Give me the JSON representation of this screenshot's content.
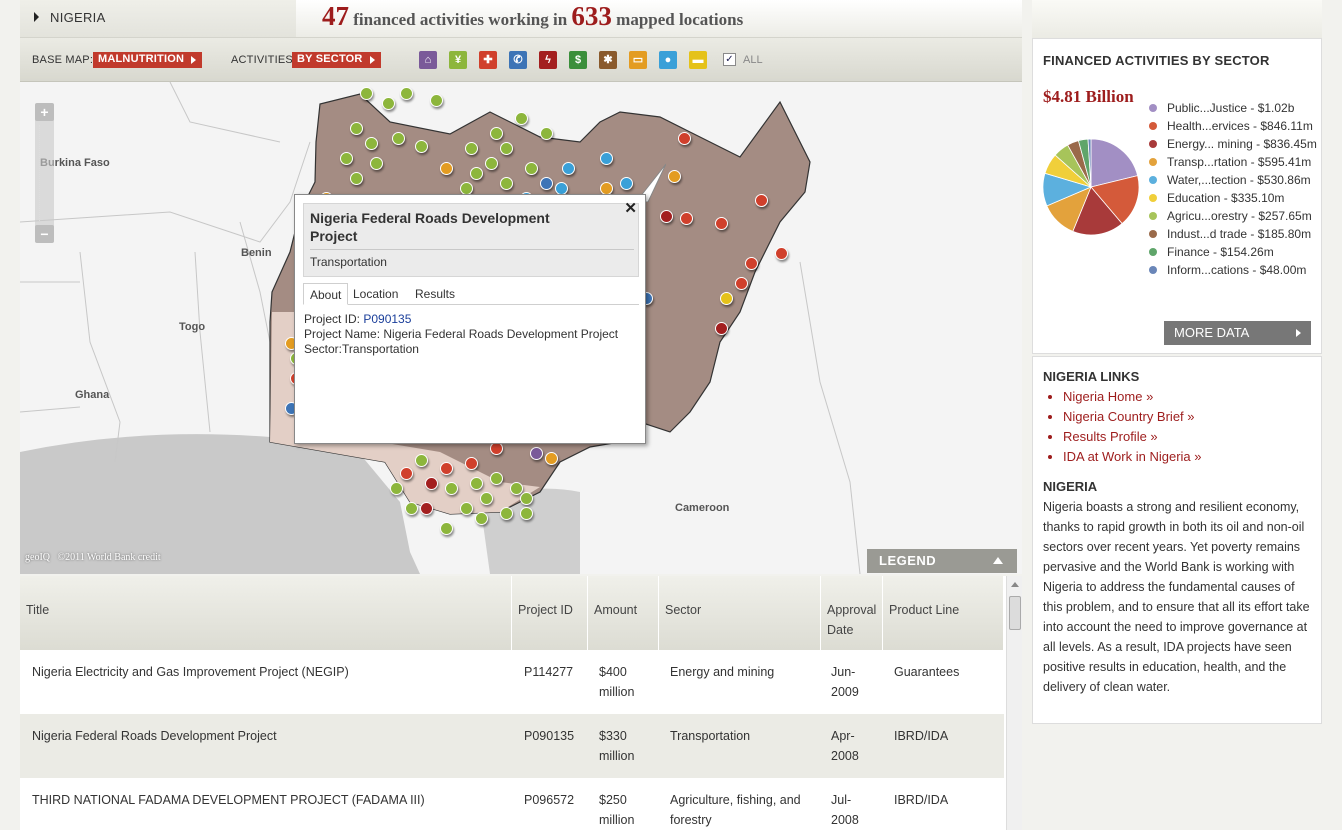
{
  "country": "NIGERIA",
  "headline": {
    "count": "47",
    "text1": "financed activities working in",
    "locations": "633",
    "text2": "mapped locations"
  },
  "toolbar": {
    "basemap_label": "BASE MAP:",
    "basemap_value": "MALNUTRITION",
    "activities_label": "ACTIVITIES:",
    "activities_value": "BY SECTOR",
    "all_label": "ALL",
    "all_checked": true,
    "sector_icons": [
      {
        "icon": "bank-icon",
        "color": "#7a5a99"
      },
      {
        "icon": "wheat-icon",
        "color": "#8db63c"
      },
      {
        "icon": "health-cross-icon",
        "color": "#d0402c"
      },
      {
        "icon": "phone-icon",
        "color": "#3d74b6"
      },
      {
        "icon": "energy-icon",
        "color": "#a31f1f"
      },
      {
        "icon": "dollar-icon",
        "color": "#3b8f3b"
      },
      {
        "icon": "industry-gear-icon",
        "color": "#8a5a2c"
      },
      {
        "icon": "transport-car-icon",
        "color": "#e39c22"
      },
      {
        "icon": "water-drop-icon",
        "color": "#3aa0d8"
      },
      {
        "icon": "education-book-icon",
        "color": "#e5c21a"
      }
    ]
  },
  "map": {
    "countries": [
      "Burkina Faso",
      "Benin",
      "Togo",
      "Ghana",
      "Cameroon"
    ],
    "credit_logo": "geoIQ",
    "credit": "©2011 World Bank credit",
    "legend_label": "LEGEND",
    "zoom_in": "+",
    "zoom_out": "−"
  },
  "popup": {
    "title": "Nigeria Federal Roads Development Project",
    "subtitle": "Transportation",
    "close": "✕",
    "tabs": [
      "About",
      "Location",
      "Results"
    ],
    "active_tab": "About",
    "project_id_label": "Project ID:",
    "project_id": "P090135",
    "project_name_line": "Project Name: Nigeria Federal Roads Development Project",
    "sector_line": "Sector:Transportation"
  },
  "table": {
    "headers": [
      "Title",
      "Project ID",
      "Amount",
      "Sector",
      "Approval Date",
      "Product Line"
    ],
    "rows": [
      {
        "title": "Nigeria Electricity and Gas Improvement Project (NEGIP)",
        "id": "P114277",
        "amount": "$400 million",
        "sector": "Energy and mining",
        "date": "Jun-2009",
        "product": "Guarantees"
      },
      {
        "title": "Nigeria Federal Roads Development Project",
        "id": "P090135",
        "amount": "$330 million",
        "sector": "Transportation",
        "date": "Apr-2008",
        "product": "IBRD/IDA"
      },
      {
        "title": "THIRD NATIONAL FADAMA DEVELOPMENT PROJECT (FADAMA III)",
        "id": "P096572",
        "amount": "$250 million",
        "sector": "Agriculture, fishing, and forestry",
        "date": "Jul-2008",
        "product": "IBRD/IDA"
      }
    ]
  },
  "sidebar": {
    "title": "FINANCED ACTIVITIES BY SECTOR",
    "total": "$4.81 Billion",
    "more_data": "MORE DATA",
    "links_title": "NIGERIA LINKS",
    "links": [
      "Nigeria Home »",
      "Nigeria Country Brief »",
      "Results Profile »",
      "IDA at Work in Nigeria »"
    ],
    "about_title": "NIGERIA",
    "about_text": "Nigeria boasts a strong and resilient economy, thanks to rapid growth in both its oil and non-oil sectors over recent years. Yet poverty remains pervasive and the World Bank is working with Nigeria to address the fundamental causes of this problem, and to ensure that all its effort take into account the need to improve governance at all levels. As a result, IDA projects have seen positive results in education, health, and the delivery of clean water."
  },
  "chart_data": {
    "type": "pie",
    "title": "FINANCED ACTIVITIES BY SECTOR",
    "total": "$4.81 Billion",
    "slices": [
      {
        "label": "Public...Justice - $1.02b",
        "value": 1020,
        "color": "#a28fc4"
      },
      {
        "label": "Health...ervices - $846.11m",
        "value": 846.11,
        "color": "#d45a3a"
      },
      {
        "label": "Energy... mining - $836.45m",
        "value": 836.45,
        "color": "#a83a3a"
      },
      {
        "label": "Transp...rtation - $595.41m",
        "value": 595.41,
        "color": "#e3a23c"
      },
      {
        "label": "Water,...tection - $530.86m",
        "value": 530.86,
        "color": "#5cb0de"
      },
      {
        "label": "Education - $335.10m",
        "value": 335.1,
        "color": "#f0cf3a"
      },
      {
        "label": "Agricu...orestry - $257.65m",
        "value": 257.65,
        "color": "#a7c45a"
      },
      {
        "label": "Indust...d trade - $185.80m",
        "value": 185.8,
        "color": "#9a6a4a"
      },
      {
        "label": "Finance - $154.26m",
        "value": 154.26,
        "color": "#5fa56a"
      },
      {
        "label": "Inform...cations - $48.00m",
        "value": 48.0,
        "color": "#6a86b8"
      }
    ]
  }
}
